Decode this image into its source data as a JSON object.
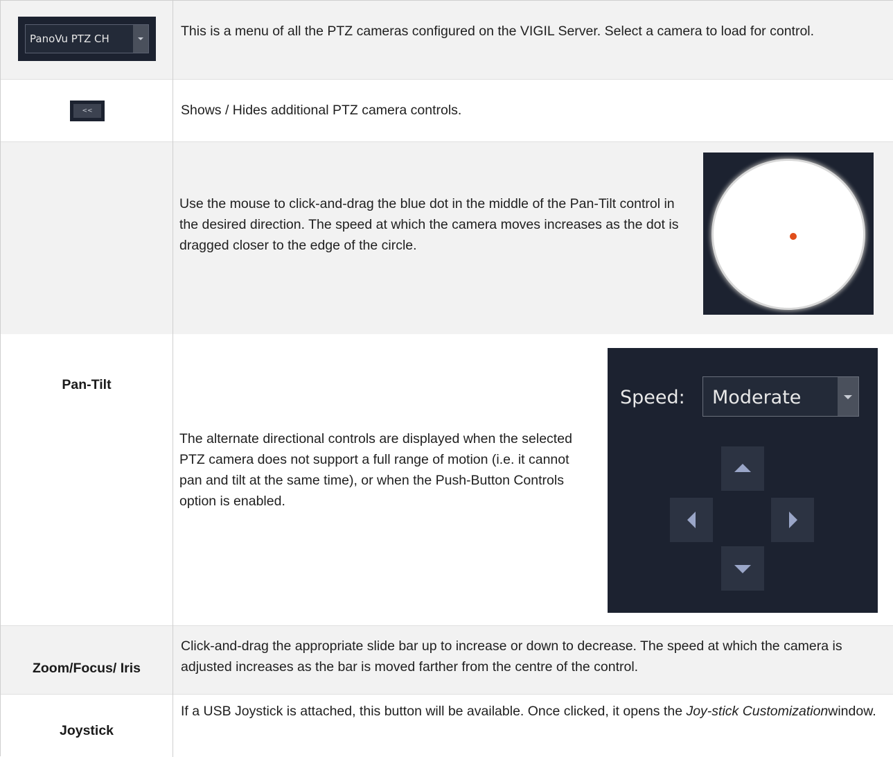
{
  "rows": {
    "camera_menu": {
      "select_value": "PanoVu PTZ CH",
      "description": "This is a menu of all the PTZ cameras configured on the VIGIL Server. Select a camera to load for control."
    },
    "toggle": {
      "button_label": "<<",
      "description": "Shows / Hides additional PTZ camera controls."
    },
    "pan_tilt": {
      "label": "Pan-Tilt",
      "description_1": "Use the mouse to click-and-drag the blue dot in the middle of the Pan-Tilt control in the desired direction. The speed at which the camera moves increases as the dot is dragged closer to the edge of the circle.",
      "description_2": "The alternate directional controls are displayed when the selected PTZ camera does not support a full range of motion (i.e. it cannot pan and tilt at the same time), or when the Push-Button Controls option is enabled.",
      "speed_label": "Speed:",
      "speed_value": "Moderate"
    },
    "zoom": {
      "label": "Zoom/Focus/ Iris",
      "description": "Click-and-drag the appropriate slide bar up to increase or down to decrease. The speed at which the camera is adjusted increases as the bar is moved farther from the centre of the control."
    },
    "joystick": {
      "label": "Joystick",
      "description_pre": "If a USB Joystick is attached, this button will be available. Once clicked, it opens the ",
      "description_italic": "Joy-stick Customization",
      "description_post": "window."
    }
  },
  "colors": {
    "row_grey": "#f2f2f2",
    "panel_dark": "#1c2230",
    "dot_orange": "#e04e1a",
    "arrow": "#9aa6c8"
  },
  "icons": [
    "chevron-down-icon",
    "arrow-up-icon",
    "arrow-down-icon",
    "arrow-left-icon",
    "arrow-right-icon"
  ]
}
